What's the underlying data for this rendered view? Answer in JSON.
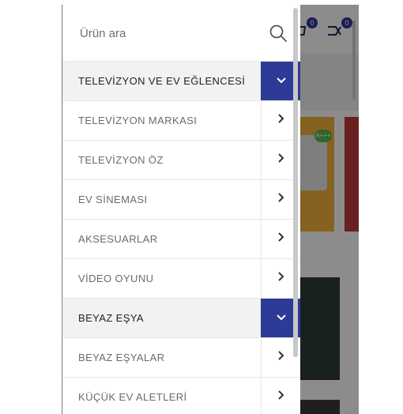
{
  "search": {
    "placeholder": "Ürün ara",
    "value": ""
  },
  "header": {
    "cart_count": "0",
    "compare_count": "0"
  },
  "background": {
    "energy_label": "A+++"
  },
  "menu": {
    "items": [
      {
        "label": "TELEVİZYON VE EV EĞLENCESİ",
        "type": "parent",
        "expanded": true
      },
      {
        "label": "TELEVİZYON MARKASI",
        "type": "child"
      },
      {
        "label": "TELEVİZYON ÖZ",
        "type": "child"
      },
      {
        "label": "EV SİNEMASI",
        "type": "child"
      },
      {
        "label": "AKSESUARLAR",
        "type": "child"
      },
      {
        "label": "VİDEO OYUNU",
        "type": "child"
      },
      {
        "label": "BEYAZ EŞYA",
        "type": "parent",
        "expanded": true
      },
      {
        "label": "BEYAZ EŞYALAR",
        "type": "child"
      },
      {
        "label": "KÜÇÜK EV ALETLERİ",
        "type": "child"
      }
    ]
  },
  "colors": {
    "accent": "#2d3a96",
    "parent_bg": "#f2f2f2",
    "text": "#6b6b6b"
  }
}
